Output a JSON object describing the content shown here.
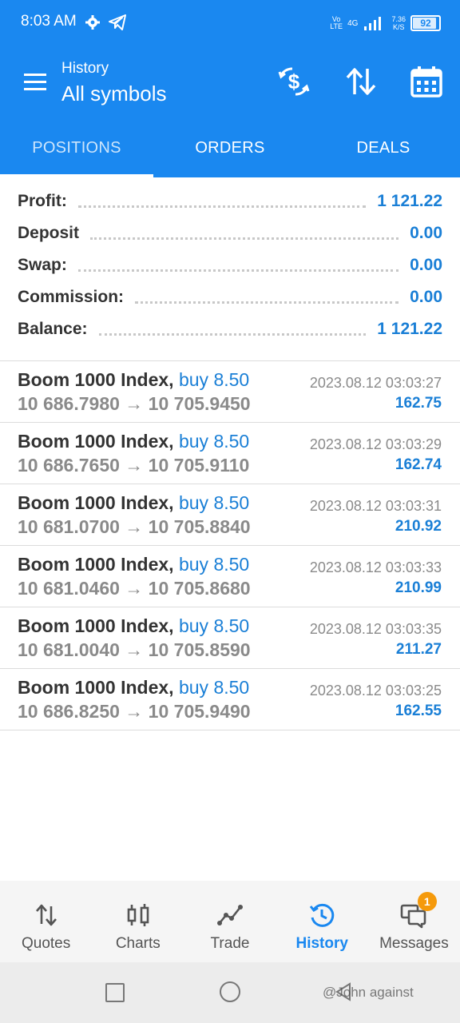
{
  "status_bar": {
    "time": "8:03 AM",
    "network_label": "Vo LTE",
    "network_type": "4G",
    "speed_value": "7.36",
    "speed_unit": "K/S",
    "battery": "92",
    "battery_level": 0.92
  },
  "header": {
    "subtitle": "History",
    "title": "All symbols",
    "icons": [
      "currency-exchange-icon",
      "sort-icon",
      "calendar-icon"
    ]
  },
  "tabs": [
    {
      "label": "POSITIONS",
      "active": true
    },
    {
      "label": "ORDERS",
      "active": false
    },
    {
      "label": "DEALS",
      "active": false
    }
  ],
  "summary": [
    {
      "label": "Profit:",
      "value": "1 121.22"
    },
    {
      "label": "Deposit",
      "value": "0.00"
    },
    {
      "label": "Swap:",
      "value": "0.00"
    },
    {
      "label": "Commission:",
      "value": "0.00"
    },
    {
      "label": "Balance:",
      "value": "1 121.22"
    }
  ],
  "deals": [
    {
      "symbol": "Boom 1000 Index,",
      "direction": "buy 8.50",
      "prices": "10 686.7980 → 10 705.9450",
      "time": "2023.08.12 03:03:27",
      "profit": "162.75"
    },
    {
      "symbol": "Boom 1000 Index,",
      "direction": "buy 8.50",
      "prices": "10 686.7650 → 10 705.9110",
      "time": "2023.08.12 03:03:29",
      "profit": "162.74"
    },
    {
      "symbol": "Boom 1000 Index,",
      "direction": "buy 8.50",
      "prices": "10 681.0700 → 10 705.8840",
      "time": "2023.08.12 03:03:31",
      "profit": "210.92"
    },
    {
      "symbol": "Boom 1000 Index,",
      "direction": "buy 8.50",
      "prices": "10 681.0460 → 10 705.8680",
      "time": "2023.08.12 03:03:33",
      "profit": "210.99"
    },
    {
      "symbol": "Boom 1000 Index,",
      "direction": "buy 8.50",
      "prices": "10 681.0040 → 10 705.8590",
      "time": "2023.08.12 03:03:35",
      "profit": "211.27"
    },
    {
      "symbol": "Boom 1000 Index,",
      "direction": "buy 8.50",
      "prices": "10 686.8250 → 10 705.9490",
      "time": "2023.08.12 03:03:25",
      "profit": "162.55"
    }
  ],
  "bottom_nav": [
    {
      "label": "Quotes",
      "icon": "quotes-icon",
      "active": false
    },
    {
      "label": "Charts",
      "icon": "charts-icon",
      "active": false
    },
    {
      "label": "Trade",
      "icon": "trade-icon",
      "active": false
    },
    {
      "label": "History",
      "icon": "history-icon",
      "active": true
    },
    {
      "label": "Messages",
      "icon": "messages-icon",
      "active": false,
      "badge": "1"
    }
  ],
  "watermark": "@John against",
  "colors": {
    "primary": "#1a88f0",
    "value_blue": "#1a7fd6",
    "badge": "#f59a0c"
  }
}
